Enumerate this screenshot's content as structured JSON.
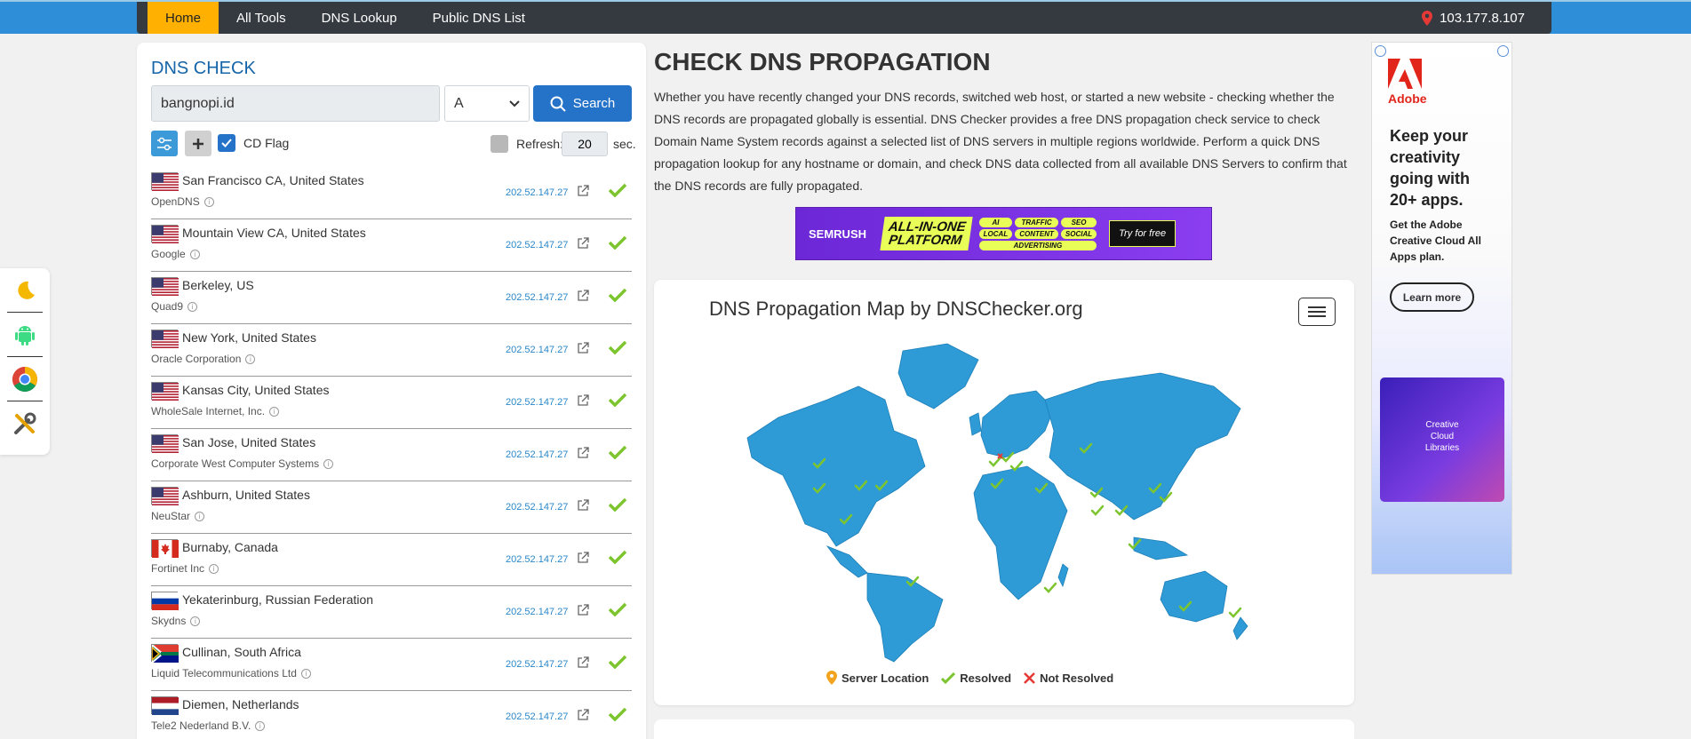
{
  "nav": {
    "items": [
      "Home",
      "All Tools",
      "DNS Lookup",
      "Public DNS List"
    ],
    "ip": "103.177.8.107"
  },
  "sidebar": {
    "icons": [
      "moon-icon",
      "android-icon",
      "chrome-icon",
      "tools-icon"
    ]
  },
  "dns_check": {
    "title": "DNS CHECK",
    "domain": "bangnopi.id",
    "record_type": "A",
    "search_label": "Search",
    "cd_flag_label": "CD Flag",
    "refresh_label": "Refresh:",
    "refresh_value": "20",
    "refresh_unit": "sec."
  },
  "results": [
    {
      "location": "San Francisco CA, United States",
      "provider": "OpenDNS",
      "ip": "202.52.147.27",
      "country": "us"
    },
    {
      "location": "Mountain View CA, United States",
      "provider": "Google",
      "ip": "202.52.147.27",
      "country": "us"
    },
    {
      "location": "Berkeley, US",
      "provider": "Quad9",
      "ip": "202.52.147.27",
      "country": "us"
    },
    {
      "location": "New York, United States",
      "provider": "Oracle Corporation",
      "ip": "202.52.147.27",
      "country": "us"
    },
    {
      "location": "Kansas City, United States",
      "provider": "WholeSale Internet, Inc.",
      "ip": "202.52.147.27",
      "country": "us"
    },
    {
      "location": "San Jose, United States",
      "provider": "Corporate West Computer Systems",
      "ip": "202.52.147.27",
      "country": "us"
    },
    {
      "location": "Ashburn, United States",
      "provider": "NeuStar",
      "ip": "202.52.147.27",
      "country": "us"
    },
    {
      "location": "Burnaby, Canada",
      "provider": "Fortinet Inc",
      "ip": "202.52.147.27",
      "country": "ca"
    },
    {
      "location": "Yekaterinburg, Russian Federation",
      "provider": "Skydns",
      "ip": "202.52.147.27",
      "country": "ru"
    },
    {
      "location": "Cullinan, South Africa",
      "provider": "Liquid Telecommunications Ltd",
      "ip": "202.52.147.27",
      "country": "za"
    },
    {
      "location": "Diemen, Netherlands",
      "provider": "Tele2 Nederland B.V.",
      "ip": "202.52.147.27",
      "country": "nl"
    }
  ],
  "main": {
    "heading": "CHECK DNS PROPAGATION",
    "description": "Whether you have recently changed your DNS records, switched web host, or started a new website - checking whether the DNS records are propagated globally is essential. DNS Checker provides a free DNS propagation check service to check Domain Name System records against a selected list of DNS servers in multiple regions worldwide. Perform a quick DNS propagation lookup for any hostname or domain, and check DNS data collected from all available DNS Servers to confirm that the DNS records are fully propagated."
  },
  "semrush_ad": {
    "logo": "SEMRUSH",
    "headline_1": "ALL-IN-ONE",
    "headline_2": "PLATFORM",
    "tags": [
      "AI",
      "TRAFFIC",
      "SEO",
      "LOCAL",
      "CONTENT",
      "SOCIAL",
      "ADVERTISING"
    ],
    "cta": "Try for free"
  },
  "map": {
    "title": "DNS Propagation Map by DNSChecker.org",
    "legend": [
      "Server Location",
      "Resolved",
      "Not Resolved"
    ]
  },
  "adobe_ad": {
    "brand": "Adobe",
    "headline": "Keep your creativity going with 20+ apps.",
    "subhead": "Get the Adobe Creative Cloud All Apps plan.",
    "cta": "Learn more",
    "image_text": "Creative Cloud Libraries"
  },
  "colors": {
    "topbar_blue": "#2e8fd8",
    "nav_dark": "#343a40",
    "nav_active": "#ffb000",
    "map_land": "#2e9bd6",
    "resolved_green": "#7dc52e",
    "not_resolved_red": "#e53935"
  }
}
